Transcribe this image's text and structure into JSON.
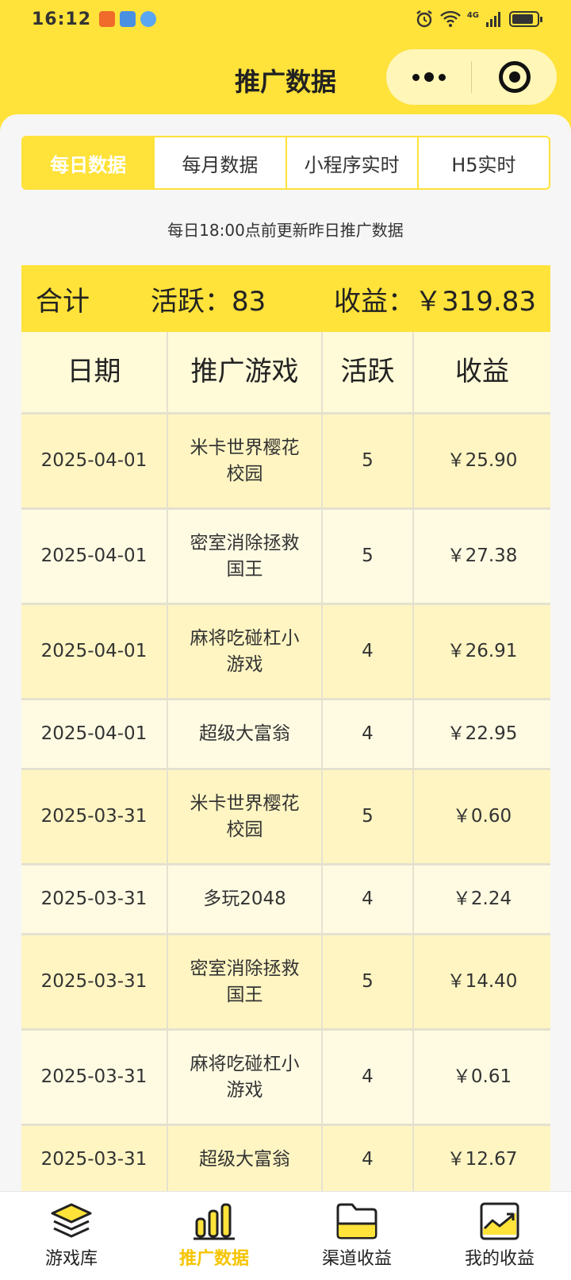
{
  "status_bar": {
    "time": "16:12",
    "network": "4G",
    "battery_level": 0.85
  },
  "nav": {
    "title": "推广数据"
  },
  "tabs": [
    {
      "label": "每日数据",
      "active": true
    },
    {
      "label": "每月数据",
      "active": false
    },
    {
      "label": "小程序实时",
      "active": false
    },
    {
      "label": "H5实时",
      "active": false
    }
  ],
  "notice": "每日18:00点前更新昨日推广数据",
  "summary": {
    "label": "合计",
    "active": "活跃：83",
    "income": "收益：￥319.83"
  },
  "table": {
    "headers": [
      "日期",
      "推广游戏",
      "活跃",
      "收益"
    ],
    "rows": [
      {
        "date": "2025-04-01",
        "game": "米卡世界樱花校园",
        "active": "5",
        "income": "￥25.90"
      },
      {
        "date": "2025-04-01",
        "game": "密室消除拯救国王",
        "active": "5",
        "income": "￥27.38"
      },
      {
        "date": "2025-04-01",
        "game": "麻将吃碰杠小游戏",
        "active": "4",
        "income": "￥26.91"
      },
      {
        "date": "2025-04-01",
        "game": "超级大富翁",
        "active": "4",
        "income": "￥22.95"
      },
      {
        "date": "2025-03-31",
        "game": "米卡世界樱花校园",
        "active": "5",
        "income": "￥0.60"
      },
      {
        "date": "2025-03-31",
        "game": "多玩2048",
        "active": "4",
        "income": "￥2.24"
      },
      {
        "date": "2025-03-31",
        "game": "密室消除拯救国王",
        "active": "5",
        "income": "￥14.40"
      },
      {
        "date": "2025-03-31",
        "game": "麻将吃碰杠小游戏",
        "active": "4",
        "income": "￥0.61"
      },
      {
        "date": "2025-03-31",
        "game": "超级大富翁",
        "active": "4",
        "income": "￥12.67"
      }
    ]
  },
  "tabbar": [
    {
      "label": "游戏库",
      "icon": "layers-icon",
      "active": false
    },
    {
      "label": "推广数据",
      "icon": "bar-chart-icon",
      "active": true
    },
    {
      "label": "渠道收益",
      "icon": "folder-icon",
      "active": false
    },
    {
      "label": "我的收益",
      "icon": "trend-chart-icon",
      "active": false
    }
  ],
  "colors": {
    "accent": "#FFE23A",
    "active_label": "#F5C400"
  }
}
